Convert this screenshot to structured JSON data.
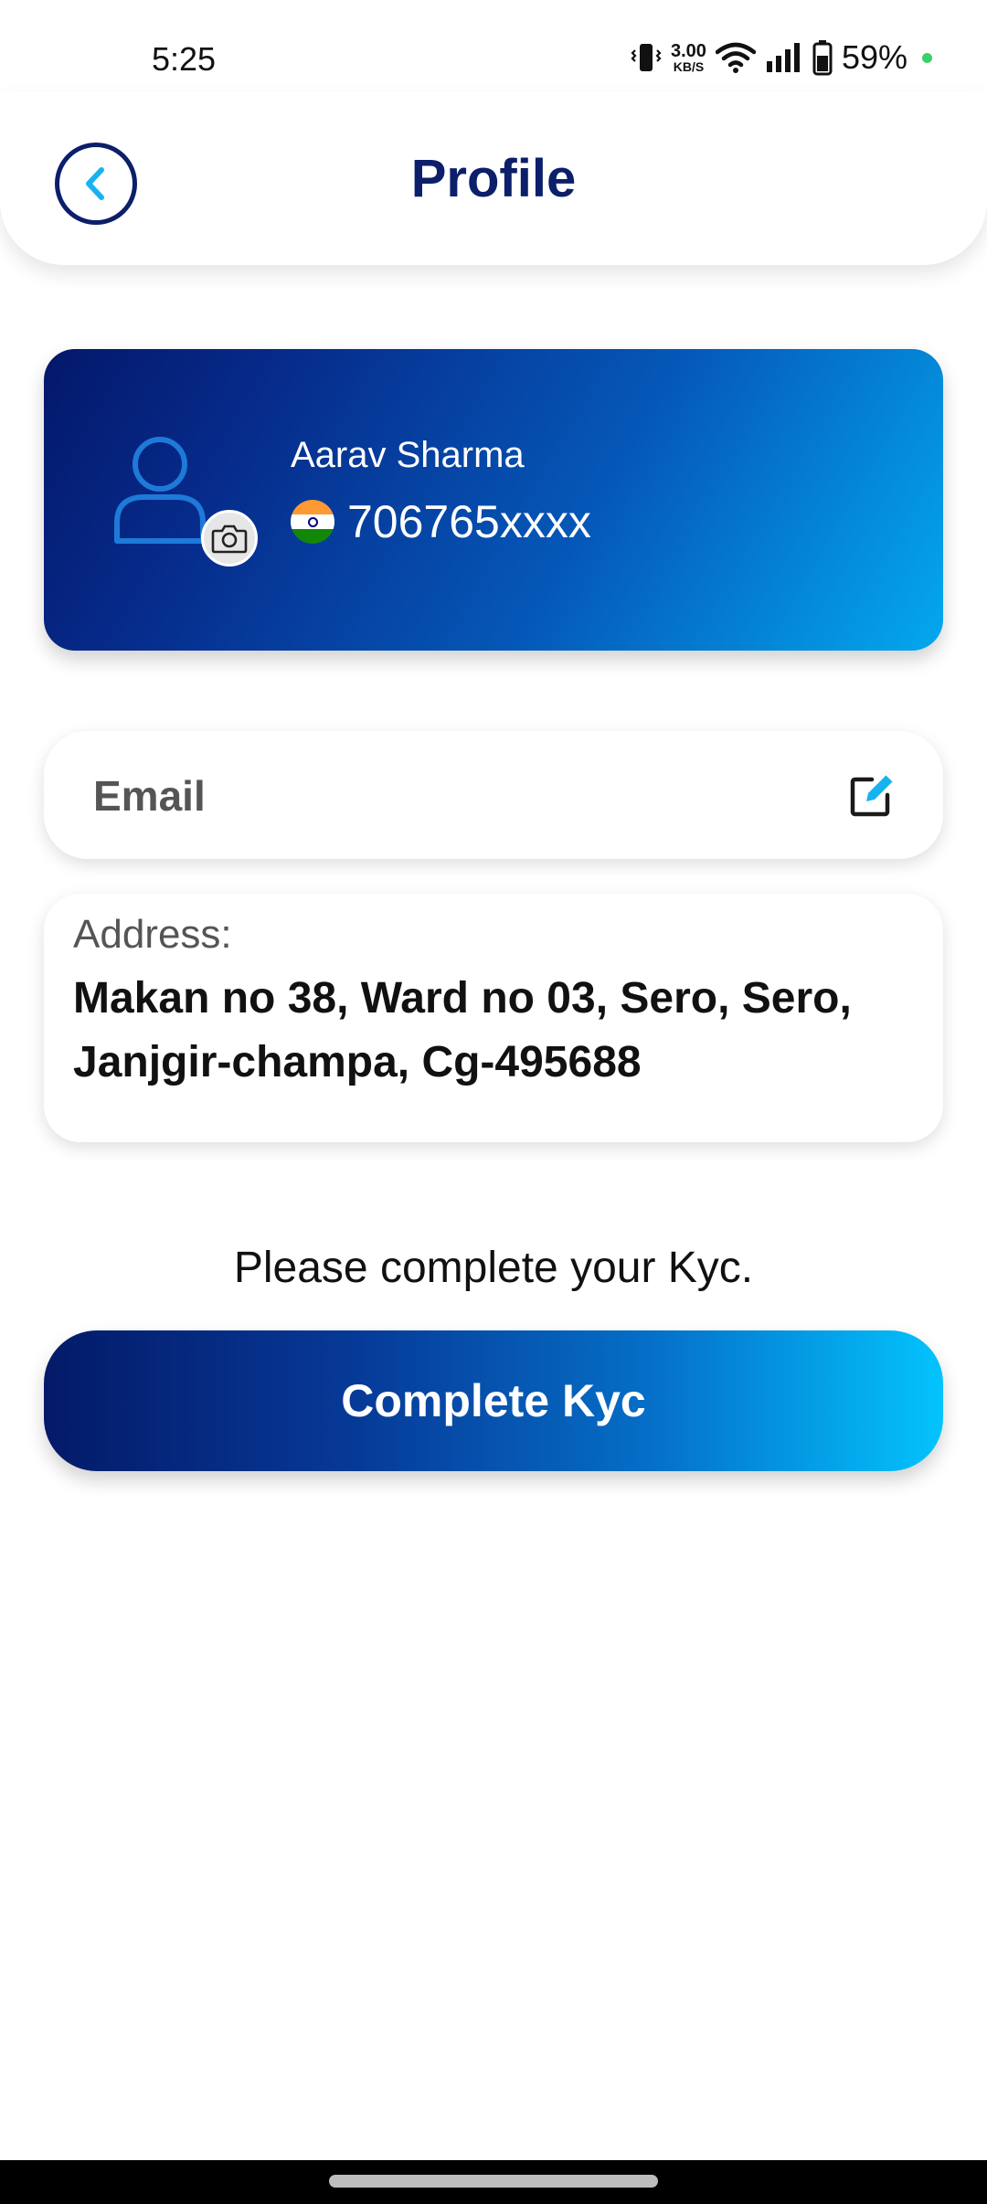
{
  "status_bar": {
    "time": "5:25",
    "net_speed_value": "3.00",
    "net_speed_unit": "KB/S",
    "battery_percent": "59%"
  },
  "header": {
    "title": "Profile",
    "back_icon": "chevron-left-icon"
  },
  "profile": {
    "name": "Aarav Sharma",
    "phone": "706765xxxx",
    "avatar_icon": "user-icon",
    "camera_icon": "camera-icon",
    "flag_icon": "india-flag-icon"
  },
  "email": {
    "label": "Email",
    "edit_icon": "edit-icon"
  },
  "address": {
    "label": "Address:",
    "value": "Makan no 38, Ward no 03, Sero, Sero, Janjgir-champa, Cg-495688"
  },
  "kyc": {
    "note": "Please complete your Kyc.",
    "button_label": "Complete Kyc"
  },
  "colors": {
    "primary_navy": "#0b1f6a",
    "accent_cyan": "#03c3fd",
    "battery_dot": "#3ccf6a"
  }
}
